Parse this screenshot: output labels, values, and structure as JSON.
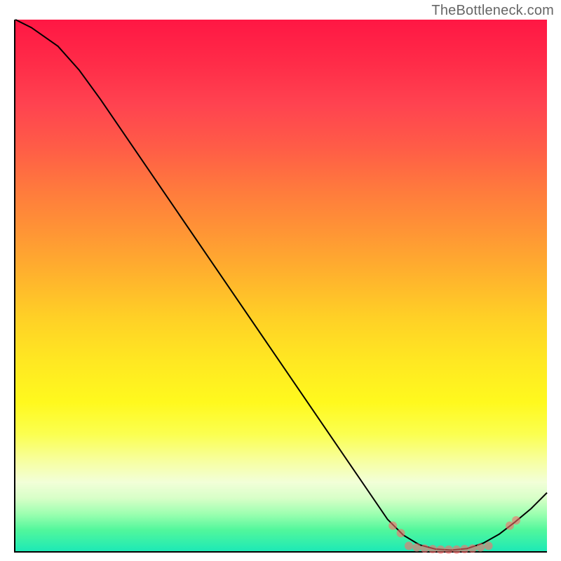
{
  "watermark": "TheBottleneck.com",
  "chart_data": {
    "type": "line",
    "title": "",
    "xlabel": "",
    "ylabel": "",
    "xlim": [
      0,
      100
    ],
    "ylim": [
      0,
      100
    ],
    "grid": false,
    "series": [
      {
        "name": "curve",
        "points": [
          {
            "x": 0,
            "y": 100
          },
          {
            "x": 3,
            "y": 98.5
          },
          {
            "x": 8,
            "y": 95
          },
          {
            "x": 12,
            "y": 90.5
          },
          {
            "x": 16,
            "y": 85
          },
          {
            "x": 70,
            "y": 6
          },
          {
            "x": 73,
            "y": 3
          },
          {
            "x": 76,
            "y": 1.2
          },
          {
            "x": 79,
            "y": 0.4
          },
          {
            "x": 82,
            "y": 0.2
          },
          {
            "x": 85,
            "y": 0.5
          },
          {
            "x": 88,
            "y": 1.5
          },
          {
            "x": 91,
            "y": 3.2
          },
          {
            "x": 94,
            "y": 5.5
          },
          {
            "x": 97,
            "y": 8
          },
          {
            "x": 100,
            "y": 11
          }
        ]
      }
    ],
    "markers": [
      {
        "x": 71,
        "y": 4.8,
        "r": 6
      },
      {
        "x": 72.5,
        "y": 3.4,
        "r": 6
      },
      {
        "x": 74,
        "y": 1.0,
        "r": 6
      },
      {
        "x": 75.5,
        "y": 0.7,
        "r": 6
      },
      {
        "x": 77,
        "y": 0.5,
        "r": 6
      },
      {
        "x": 78.5,
        "y": 0.4,
        "r": 6
      },
      {
        "x": 80,
        "y": 0.3,
        "r": 6
      },
      {
        "x": 81.5,
        "y": 0.3,
        "r": 6
      },
      {
        "x": 83,
        "y": 0.3,
        "r": 6
      },
      {
        "x": 84.5,
        "y": 0.4,
        "r": 6
      },
      {
        "x": 86,
        "y": 0.5,
        "r": 6
      },
      {
        "x": 87.5,
        "y": 0.7,
        "r": 6
      },
      {
        "x": 89,
        "y": 1.0,
        "r": 6
      },
      {
        "x": 93,
        "y": 4.8,
        "r": 6
      },
      {
        "x": 94.2,
        "y": 5.8,
        "r": 6
      }
    ],
    "gradient_stops": [
      {
        "pos": 0,
        "color": "#ff1744"
      },
      {
        "pos": 50,
        "color": "#ffd026"
      },
      {
        "pos": 75,
        "color": "#fff91e"
      },
      {
        "pos": 100,
        "color": "#1de9b6"
      }
    ]
  }
}
